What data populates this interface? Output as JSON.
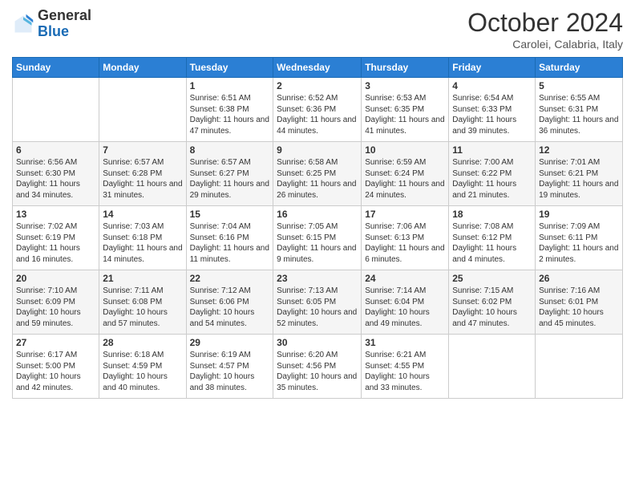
{
  "header": {
    "logo_general": "General",
    "logo_blue": "Blue",
    "month": "October 2024",
    "location": "Carolei, Calabria, Italy"
  },
  "weekdays": [
    "Sunday",
    "Monday",
    "Tuesday",
    "Wednesday",
    "Thursday",
    "Friday",
    "Saturday"
  ],
  "weeks": [
    [
      {
        "day": "",
        "info": ""
      },
      {
        "day": "",
        "info": ""
      },
      {
        "day": "1",
        "info": "Sunrise: 6:51 AM\nSunset: 6:38 PM\nDaylight: 11 hours and 47 minutes."
      },
      {
        "day": "2",
        "info": "Sunrise: 6:52 AM\nSunset: 6:36 PM\nDaylight: 11 hours and 44 minutes."
      },
      {
        "day": "3",
        "info": "Sunrise: 6:53 AM\nSunset: 6:35 PM\nDaylight: 11 hours and 41 minutes."
      },
      {
        "day": "4",
        "info": "Sunrise: 6:54 AM\nSunset: 6:33 PM\nDaylight: 11 hours and 39 minutes."
      },
      {
        "day": "5",
        "info": "Sunrise: 6:55 AM\nSunset: 6:31 PM\nDaylight: 11 hours and 36 minutes."
      }
    ],
    [
      {
        "day": "6",
        "info": "Sunrise: 6:56 AM\nSunset: 6:30 PM\nDaylight: 11 hours and 34 minutes."
      },
      {
        "day": "7",
        "info": "Sunrise: 6:57 AM\nSunset: 6:28 PM\nDaylight: 11 hours and 31 minutes."
      },
      {
        "day": "8",
        "info": "Sunrise: 6:57 AM\nSunset: 6:27 PM\nDaylight: 11 hours and 29 minutes."
      },
      {
        "day": "9",
        "info": "Sunrise: 6:58 AM\nSunset: 6:25 PM\nDaylight: 11 hours and 26 minutes."
      },
      {
        "day": "10",
        "info": "Sunrise: 6:59 AM\nSunset: 6:24 PM\nDaylight: 11 hours and 24 minutes."
      },
      {
        "day": "11",
        "info": "Sunrise: 7:00 AM\nSunset: 6:22 PM\nDaylight: 11 hours and 21 minutes."
      },
      {
        "day": "12",
        "info": "Sunrise: 7:01 AM\nSunset: 6:21 PM\nDaylight: 11 hours and 19 minutes."
      }
    ],
    [
      {
        "day": "13",
        "info": "Sunrise: 7:02 AM\nSunset: 6:19 PM\nDaylight: 11 hours and 16 minutes."
      },
      {
        "day": "14",
        "info": "Sunrise: 7:03 AM\nSunset: 6:18 PM\nDaylight: 11 hours and 14 minutes."
      },
      {
        "day": "15",
        "info": "Sunrise: 7:04 AM\nSunset: 6:16 PM\nDaylight: 11 hours and 11 minutes."
      },
      {
        "day": "16",
        "info": "Sunrise: 7:05 AM\nSunset: 6:15 PM\nDaylight: 11 hours and 9 minutes."
      },
      {
        "day": "17",
        "info": "Sunrise: 7:06 AM\nSunset: 6:13 PM\nDaylight: 11 hours and 6 minutes."
      },
      {
        "day": "18",
        "info": "Sunrise: 7:08 AM\nSunset: 6:12 PM\nDaylight: 11 hours and 4 minutes."
      },
      {
        "day": "19",
        "info": "Sunrise: 7:09 AM\nSunset: 6:11 PM\nDaylight: 11 hours and 2 minutes."
      }
    ],
    [
      {
        "day": "20",
        "info": "Sunrise: 7:10 AM\nSunset: 6:09 PM\nDaylight: 10 hours and 59 minutes."
      },
      {
        "day": "21",
        "info": "Sunrise: 7:11 AM\nSunset: 6:08 PM\nDaylight: 10 hours and 57 minutes."
      },
      {
        "day": "22",
        "info": "Sunrise: 7:12 AM\nSunset: 6:06 PM\nDaylight: 10 hours and 54 minutes."
      },
      {
        "day": "23",
        "info": "Sunrise: 7:13 AM\nSunset: 6:05 PM\nDaylight: 10 hours and 52 minutes."
      },
      {
        "day": "24",
        "info": "Sunrise: 7:14 AM\nSunset: 6:04 PM\nDaylight: 10 hours and 49 minutes."
      },
      {
        "day": "25",
        "info": "Sunrise: 7:15 AM\nSunset: 6:02 PM\nDaylight: 10 hours and 47 minutes."
      },
      {
        "day": "26",
        "info": "Sunrise: 7:16 AM\nSunset: 6:01 PM\nDaylight: 10 hours and 45 minutes."
      }
    ],
    [
      {
        "day": "27",
        "info": "Sunrise: 6:17 AM\nSunset: 5:00 PM\nDaylight: 10 hours and 42 minutes."
      },
      {
        "day": "28",
        "info": "Sunrise: 6:18 AM\nSunset: 4:59 PM\nDaylight: 10 hours and 40 minutes."
      },
      {
        "day": "29",
        "info": "Sunrise: 6:19 AM\nSunset: 4:57 PM\nDaylight: 10 hours and 38 minutes."
      },
      {
        "day": "30",
        "info": "Sunrise: 6:20 AM\nSunset: 4:56 PM\nDaylight: 10 hours and 35 minutes."
      },
      {
        "day": "31",
        "info": "Sunrise: 6:21 AM\nSunset: 4:55 PM\nDaylight: 10 hours and 33 minutes."
      },
      {
        "day": "",
        "info": ""
      },
      {
        "day": "",
        "info": ""
      }
    ]
  ]
}
